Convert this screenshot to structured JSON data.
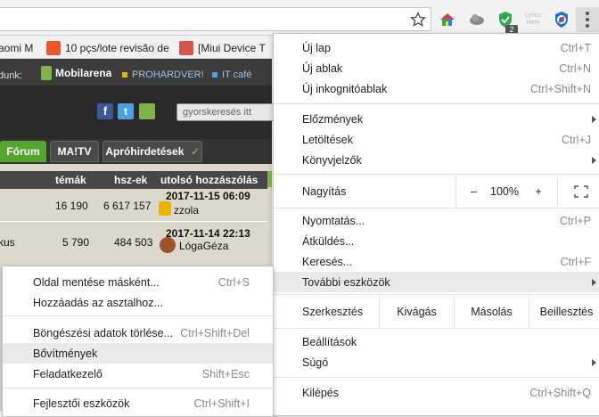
{
  "toolbar": {
    "star_icon": "star-outline",
    "ext_lyrics_label": "Lyrics Here",
    "ext_badge_count": "2",
    "menu_icon": "three-dots-vertical"
  },
  "bookmarks": [
    {
      "label": "aomi M"
    },
    {
      "label": "10 pçs/lote revisão de"
    },
    {
      "label": "[Miui Device T"
    }
  ],
  "site": {
    "partner_prefix": "dunk:",
    "partners": [
      "Mobilarena",
      "PROHARDVER!",
      "IT café"
    ],
    "search_placeholder": "gyorskeresés itt",
    "nav": {
      "forum": "Fórum",
      "matv": "MA!TV",
      "classifieds": "Apróhirdetések"
    },
    "table": {
      "headers": [
        "témák",
        "hsz-ek",
        "utolsó hozzászólás"
      ],
      "rows": [
        {
          "name": "",
          "topics": "16 190",
          "posts": "6 617 157",
          "date": "2017-11-15 06:09",
          "user": "zzola"
        },
        {
          "name": "kus",
          "topics": "5 790",
          "posts": "484 503",
          "date": "2017-11-14 22:13",
          "user": "LógaGéza"
        }
      ]
    }
  },
  "main_menu": {
    "items": {
      "new_tab": {
        "label": "Új lap",
        "shortcut": "Ctrl+T"
      },
      "new_window": {
        "label": "Új ablak",
        "shortcut": "Ctrl+N"
      },
      "incognito": {
        "label": "Új inkognitóablak",
        "shortcut": "Ctrl+Shift+N"
      },
      "history": {
        "label": "Előzmények"
      },
      "downloads": {
        "label": "Letöltések",
        "shortcut": "Ctrl+J"
      },
      "bookmarks": {
        "label": "Könyvjelzők"
      },
      "zoom": {
        "label": "Nagyítás",
        "minus": "–",
        "value": "100%",
        "plus": "+"
      },
      "print": {
        "label": "Nyomtatás...",
        "shortcut": "Ctrl+P"
      },
      "cast": {
        "label": "Átküldés..."
      },
      "find": {
        "label": "Keresés...",
        "shortcut": "Ctrl+F"
      },
      "more_tools": {
        "label": "További eszközök"
      },
      "edit": {
        "label": "Szerkesztés",
        "cut": "Kivágás",
        "copy": "Másolás",
        "paste": "Beillesztés"
      },
      "settings": {
        "label": "Beállítások"
      },
      "help": {
        "label": "Súgó"
      },
      "exit": {
        "label": "Kilépés",
        "shortcut": "Ctrl+Shift+Q"
      }
    }
  },
  "sub_menu": {
    "save_page": {
      "label": "Oldal mentése másként...",
      "shortcut": "Ctrl+S"
    },
    "add_desktop": {
      "label": "Hozzáadás az asztalhoz..."
    },
    "clear_data": {
      "label": "Böngészési adatok törlése...",
      "shortcut": "Ctrl+Shift+Del"
    },
    "extensions": {
      "label": "Bővítmények"
    },
    "task_manager": {
      "label": "Feladatkezelő",
      "shortcut": "Shift+Esc"
    },
    "dev_tools": {
      "label": "Fejlesztői eszközök",
      "shortcut": "Ctrl+Shift+I"
    }
  }
}
